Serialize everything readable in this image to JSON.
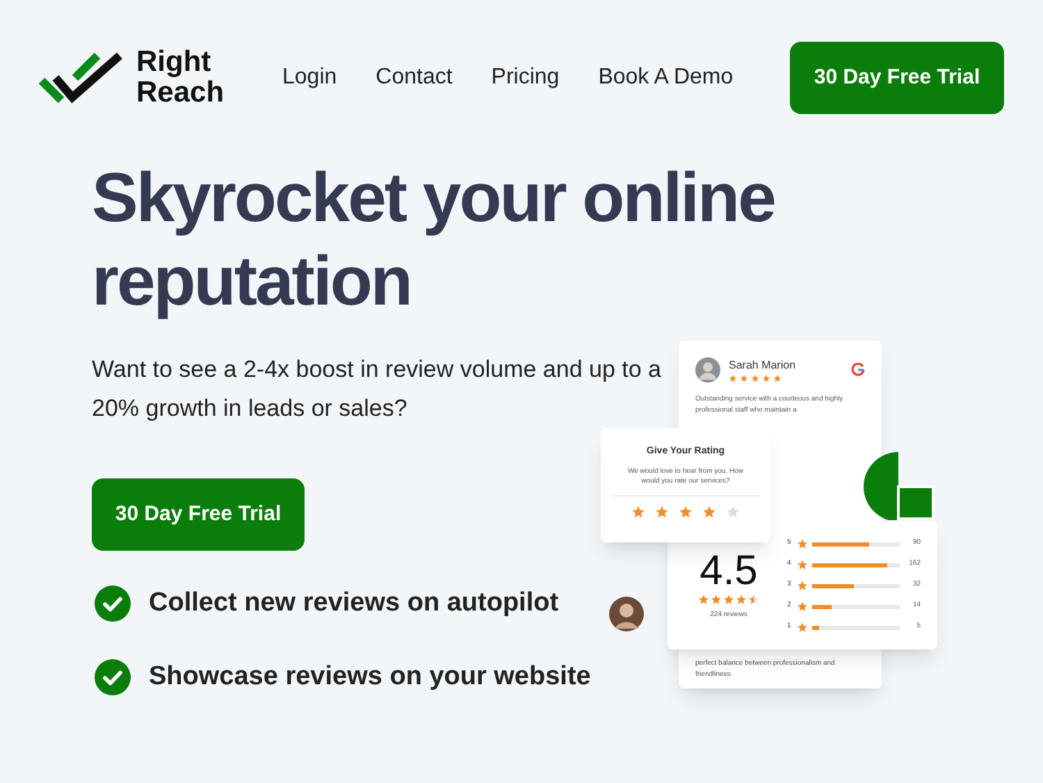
{
  "logo": {
    "line_1": "Right",
    "line_2": "Reach"
  },
  "nav": {
    "links": [
      "Login",
      "Contact",
      "Pricing",
      "Book A Demo"
    ],
    "cta": "30 Day Free Trial"
  },
  "hero": {
    "title": "Skyrocket your online reputation",
    "subtitle": "Want to see a 2-4x boost in review volume and up to a 20% growth in leads or sales?",
    "cta": "30 Day Free Trial",
    "features": [
      "Collect new reviews on autopilot",
      "Showcase reviews on your website"
    ]
  },
  "review_card": {
    "name": "Sarah Marion",
    "stars": 5,
    "text": "Outstanding service with a courteous and highly professional staff who maintain a",
    "footer_text": "perfect balance between professionalism and friendliness."
  },
  "rating_card": {
    "title": "Give Your Rating",
    "text": "We would love to hear from you. How would you rate our services?",
    "stars": 4
  },
  "summary_card": {
    "score": "4.5",
    "stars": 4.5,
    "count": "224 reviews",
    "bars": [
      {
        "label": "5",
        "level": 0.65,
        "count": "90"
      },
      {
        "label": "4",
        "level": 0.85,
        "count": "162"
      },
      {
        "label": "3",
        "level": 0.47,
        "count": "32"
      },
      {
        "label": "2",
        "level": 0.23,
        "count": "14"
      },
      {
        "label": "1",
        "level": 0.08,
        "count": "5"
      }
    ]
  }
}
